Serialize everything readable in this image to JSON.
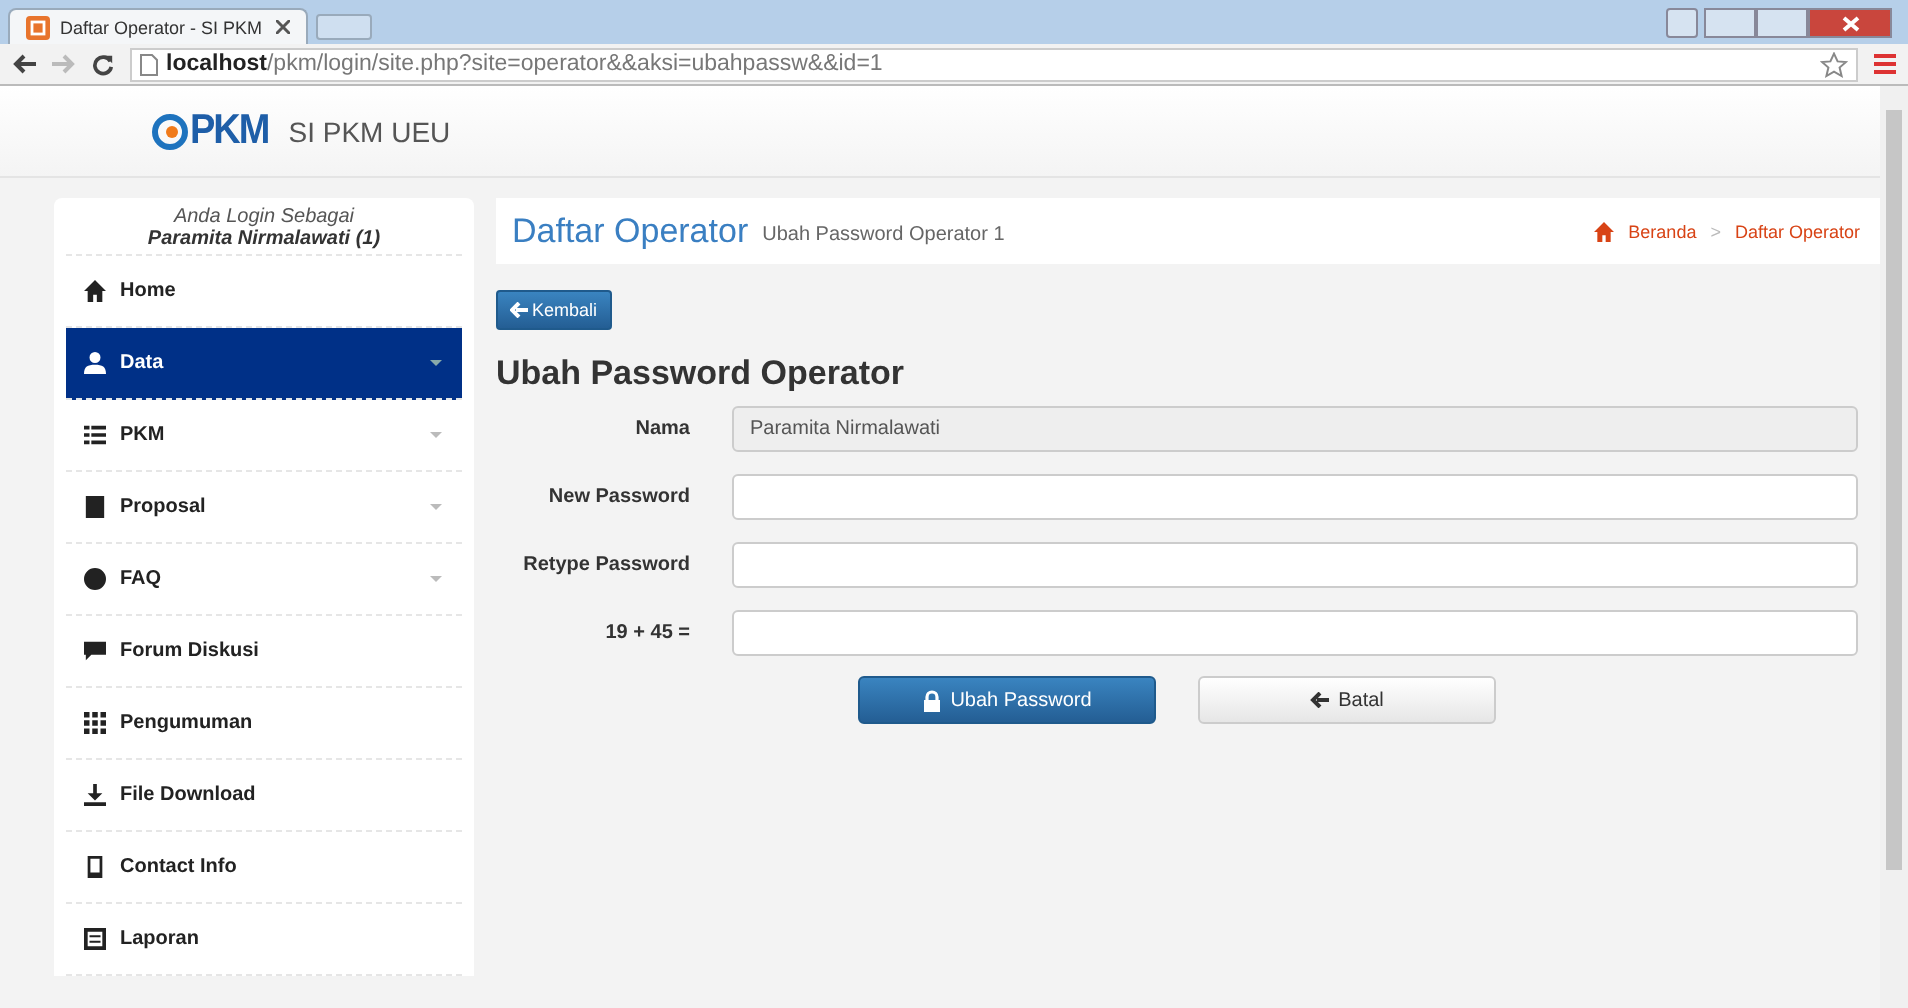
{
  "browser": {
    "tab_title": "Daftar Operator - SI PKM",
    "url_host": "localhost",
    "url_path": "/pkm/login/site.php?site=operator&&aksi=ubahpassw&&id=1"
  },
  "header": {
    "brand": "SI PKM UEU",
    "logo_text": "PKM"
  },
  "sidebar": {
    "login_label": "Anda Login Sebagai",
    "user": "Paramita Nirmalawati (1)",
    "items": [
      {
        "label": "Home",
        "selected": false,
        "expandable": false
      },
      {
        "label": "Data",
        "selected": true,
        "expandable": true
      },
      {
        "label": "PKM",
        "selected": false,
        "expandable": true
      },
      {
        "label": "Proposal",
        "selected": false,
        "expandable": true
      },
      {
        "label": "FAQ",
        "selected": false,
        "expandable": true
      },
      {
        "label": "Forum Diskusi",
        "selected": false,
        "expandable": false
      },
      {
        "label": "Pengumuman",
        "selected": false,
        "expandable": false
      },
      {
        "label": "File Download",
        "selected": false,
        "expandable": false
      },
      {
        "label": "Contact Info",
        "selected": false,
        "expandable": false
      },
      {
        "label": "Laporan",
        "selected": false,
        "expandable": false
      }
    ]
  },
  "page_title": {
    "title": "Daftar Operator",
    "subtitle": "Ubah Password Operator 1",
    "breadcrumb": [
      "Beranda",
      "Daftar Operator"
    ],
    "breadcrumb_separator": ">"
  },
  "back_button": "Kembali",
  "form": {
    "heading": "Ubah Password Operator",
    "fields": [
      {
        "label": "Nama",
        "value": "Paramita Nirmalawati",
        "disabled": true
      },
      {
        "label": "New Password",
        "disabled": false
      },
      {
        "label": "Retype Password",
        "disabled": false
      },
      {
        "label": "19 + 45 =",
        "disabled": false
      }
    ],
    "submit": "Ubah Password",
    "cancel": "Batal"
  }
}
